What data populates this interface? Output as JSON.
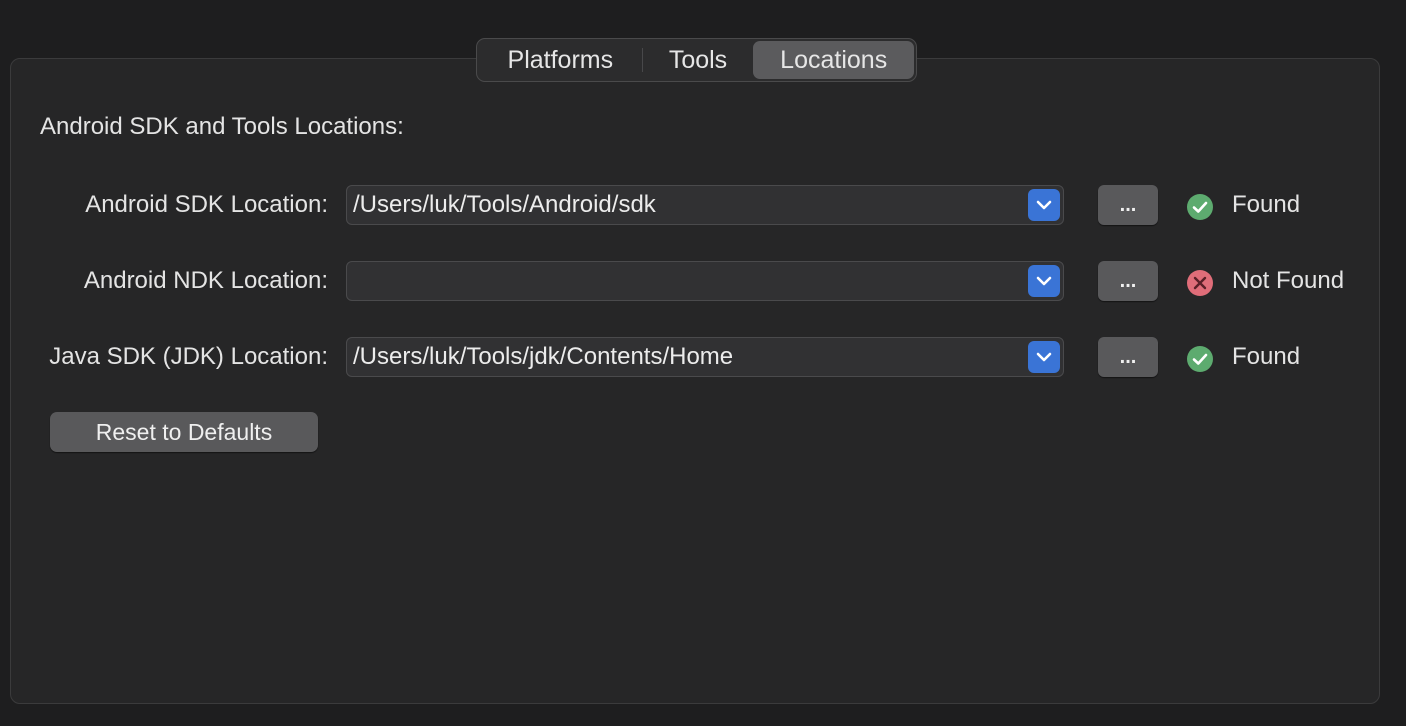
{
  "tabs": [
    "Platforms",
    "Tools",
    "Locations"
  ],
  "selected_tab": "Locations",
  "section_title": "Android SDK and Tools Locations:",
  "rows": [
    {
      "label": "Android SDK Location:",
      "value": "/Users/luk/Tools/Android/sdk",
      "browse_label": "...",
      "status": "Found",
      "status_icon": "check-circle-icon",
      "status_color": "#5dab6f"
    },
    {
      "label": "Android NDK Location:",
      "value": "",
      "browse_label": "...",
      "status": "Not Found",
      "status_icon": "x-circle-icon",
      "status_color": "#e06d79"
    },
    {
      "label": "Java SDK (JDK) Location:",
      "value": "/Users/luk/Tools/jdk/Contents/Home",
      "browse_label": "...",
      "status": "Found",
      "status_icon": "check-circle-icon",
      "status_color": "#5dab6f"
    }
  ],
  "reset_label": "Reset to Defaults",
  "colors": {
    "accent": "#3a74d6",
    "selected_tab": "#5b5b5d",
    "found": "#5dab6f",
    "not_found": "#e06d79"
  }
}
